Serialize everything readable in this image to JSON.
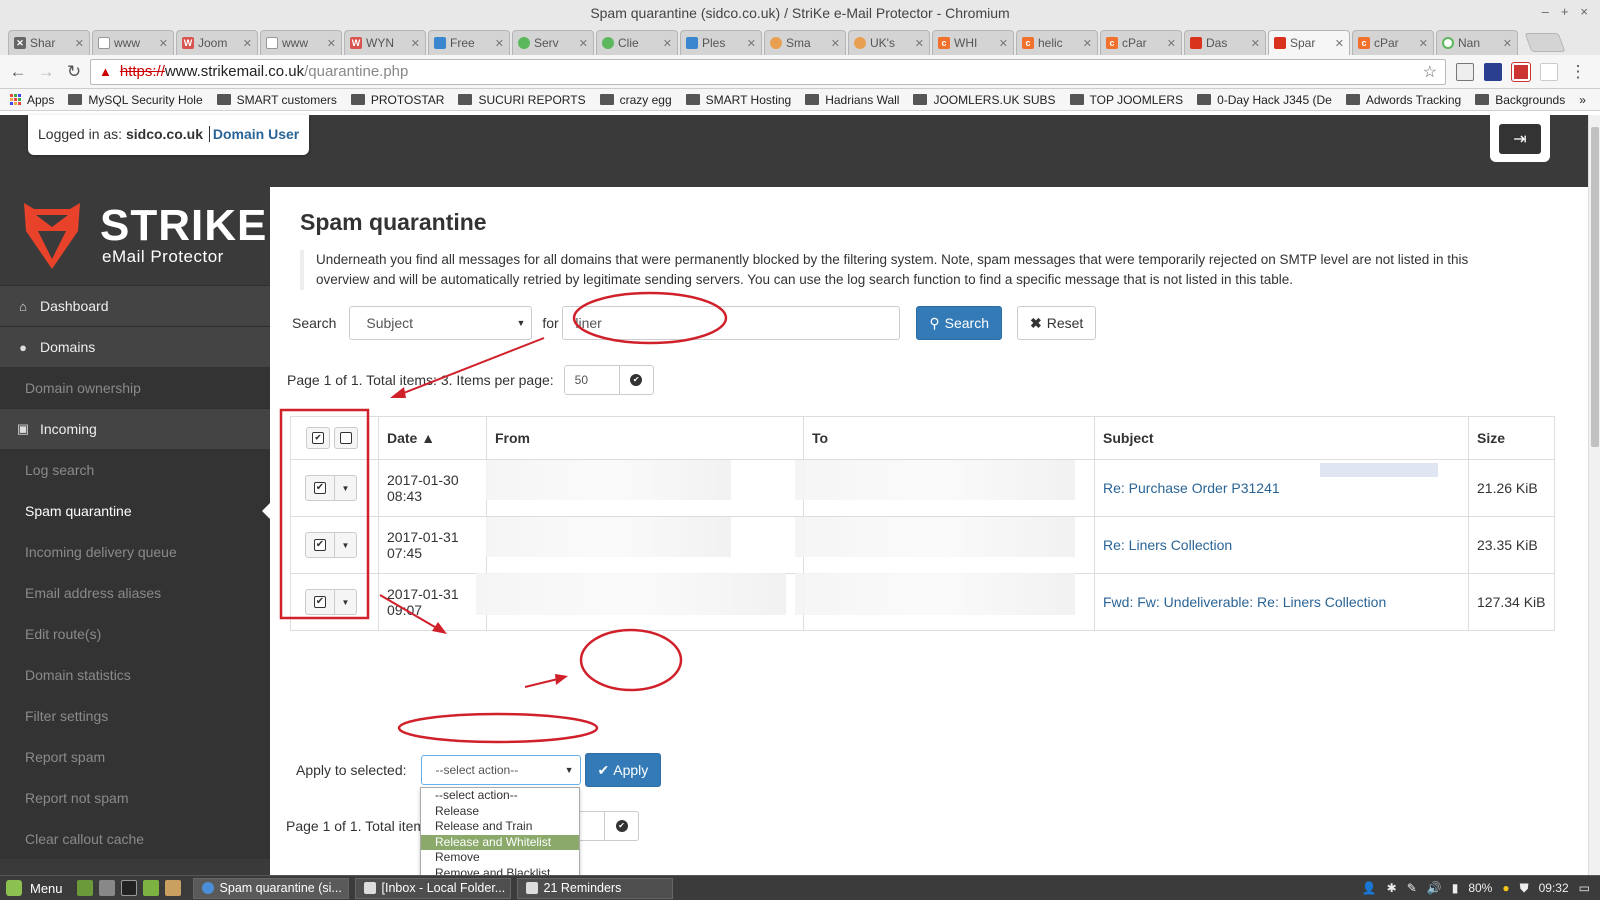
{
  "window": {
    "title": "Spam quarantine (sidco.co.uk) / StriKe e-Mail Protector - Chromium"
  },
  "tabs": [
    {
      "label": "Shar",
      "icon": "wrench-icon",
      "color": "#666666"
    },
    {
      "label": "www",
      "icon": "page-icon",
      "color": "#999999"
    },
    {
      "label": "Joom",
      "icon": "w-icon",
      "color": "#d9534f"
    },
    {
      "label": "www",
      "icon": "page-icon",
      "color": "#999999"
    },
    {
      "label": "WYN",
      "icon": "w-icon",
      "color": "#d9534f"
    },
    {
      "label": "Free",
      "icon": "tag-icon",
      "color": "#3a87d0"
    },
    {
      "label": "Serv",
      "icon": "leaf-icon",
      "color": "#5cb85c"
    },
    {
      "label": "Clie",
      "icon": "leaf-icon",
      "color": "#5cb85c"
    },
    {
      "label": "Ples",
      "icon": "plesk-icon",
      "color": "#3a87d0"
    },
    {
      "label": "Sma",
      "icon": "face-icon",
      "color": "#e8a050"
    },
    {
      "label": "UK's",
      "icon": "face-icon",
      "color": "#e8a050"
    },
    {
      "label": "WHI",
      "icon": "cp-icon",
      "color": "#f0702c"
    },
    {
      "label": "helic",
      "icon": "cp-icon",
      "color": "#f0702c"
    },
    {
      "label": "cPar",
      "icon": "cp-icon",
      "color": "#f0702c"
    },
    {
      "label": "Das",
      "icon": "strike-icon",
      "color": "#d9331e"
    },
    {
      "label": "Spar",
      "icon": "strike-icon",
      "color": "#d9331e",
      "active": true
    },
    {
      "label": "cPar",
      "icon": "cp-icon",
      "color": "#f0702c"
    },
    {
      "label": "Nan",
      "icon": "spinner-icon",
      "color": "#5cb85c"
    }
  ],
  "address": {
    "protocol": "https://",
    "host": "www.strikemail.co.uk",
    "path": "/quarantine.php"
  },
  "bookmarks": {
    "apps_label": "Apps",
    "items": [
      "MySQL Security Hole",
      "SMART customers",
      "PROTOSTAR",
      "SUCURI REPORTS",
      "crazy egg",
      "SMART Hosting",
      "Hadrians Wall",
      "JOOMLERS.UK SUBS",
      "TOP JOOMLERS",
      "0-Day Hack J345 (De",
      "Adwords Tracking",
      "Backgrounds"
    ],
    "more": "»"
  },
  "header": {
    "logged_prefix": "Logged in as:",
    "domain": "sidco.co.uk",
    "role": "Domain User"
  },
  "brand": {
    "name": "STRIKE",
    "tagline": "eMail Protector",
    "color": "#e8432a"
  },
  "sidebar": {
    "dashboard": "Dashboard",
    "domains": "Domains",
    "domain_ownership": "Domain ownership",
    "incoming": "Incoming",
    "sub": [
      "Log search",
      "Spam quarantine",
      "Incoming delivery queue",
      "Email address aliases",
      "Edit route(s)",
      "Domain statistics",
      "Filter settings",
      "Report spam",
      "Report not spam",
      "Clear callout cache"
    ]
  },
  "main": {
    "title": "Spam quarantine",
    "description": "Underneath you find all messages for all domains that were permanently blocked by the filtering system. Note, spam messages that were temporarily rejected on SMTP level are not listed in this overview and will be automatically retried by legitimate sending servers. You can use the log search function to find a specific message that is not listed in this table.",
    "search_label": "Search",
    "search_field": "Subject",
    "for_label": "for",
    "search_value": "liner",
    "search_button": "Search",
    "reset_button": "Reset",
    "pager_text": "Page 1 of 1. Total items: 3. Items per page:",
    "items_per_page": "50",
    "pager_text_short": "Page 1 of 1. Total item"
  },
  "table": {
    "headers": {
      "date": "Date ▲",
      "from": "From",
      "to": "To",
      "subject": "Subject",
      "size": "Size"
    },
    "rows": [
      {
        "date": "2017-01-30 08:43",
        "subject": "Re: Purchase Order P31241",
        "size": "21.26 KiB"
      },
      {
        "date": "2017-01-31 07:45",
        "subject": "Re: Liners Collection",
        "size": "23.35 KiB"
      },
      {
        "date": "2017-01-31 09:07",
        "subject": "Fwd: Fw: Undeliverable: Re: Liners Collection",
        "size": "127.34 KiB"
      }
    ]
  },
  "apply": {
    "label": "Apply to selected:",
    "selected": "--select action--",
    "button": "Apply",
    "options": [
      "--select action--",
      "Release",
      "Release and Train",
      "Release and Whitelist",
      "Remove",
      "Remove and Blacklist"
    ]
  },
  "taskbar": {
    "menu": "Menu",
    "tasks": [
      "Spam quarantine (si...",
      "[Inbox - Local Folder...",
      "21 Reminders"
    ],
    "battery": "80%",
    "time": "09:32"
  },
  "colors": {
    "accent": "#337ab7",
    "link": "#2a6496",
    "annotation": "#d0202a",
    "highlight": "#8aa96a"
  }
}
